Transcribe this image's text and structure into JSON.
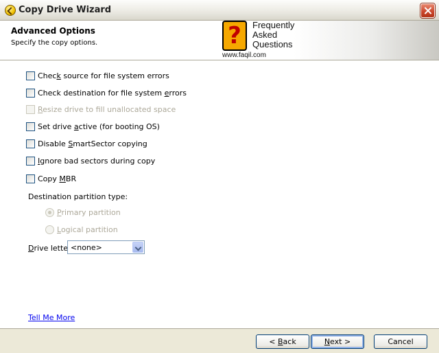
{
  "window": {
    "title": "Copy Drive Wizard"
  },
  "header": {
    "title": "Advanced Options",
    "subtitle": "Specify the copy options."
  },
  "banner": {
    "logo_glyph": "?",
    "line1": "Frequently",
    "line2": "Asked",
    "line3": "Questions",
    "url": "www.faqil.com"
  },
  "options": [
    {
      "pre": "Chec",
      "key": "k",
      "post": " source for file system errors",
      "checked": false,
      "enabled": true
    },
    {
      "pre": "Check destination for file system ",
      "key": "e",
      "post": "rrors",
      "checked": false,
      "enabled": true
    },
    {
      "pre": "",
      "key": "R",
      "post": "esize drive to fill unallocated space",
      "checked": false,
      "enabled": false
    },
    {
      "pre": "Set drive ",
      "key": "a",
      "post": "ctive (for booting OS)",
      "checked": false,
      "enabled": true
    },
    {
      "pre": "Disable ",
      "key": "S",
      "post": "martSector copying",
      "checked": false,
      "enabled": true
    },
    {
      "pre": "",
      "key": "I",
      "post": "gnore bad sectors during copy",
      "checked": false,
      "enabled": true
    },
    {
      "pre": "Copy ",
      "key": "M",
      "post": "BR",
      "checked": false,
      "enabled": true
    }
  ],
  "partition": {
    "label": "Destination partition type:",
    "primary": {
      "pre": "",
      "key": "P",
      "post": "rimary partition",
      "selected": true,
      "enabled": false
    },
    "logical": {
      "pre": "",
      "key": "L",
      "post": "ogical partition",
      "selected": false,
      "enabled": false
    }
  },
  "drive_letter": {
    "pre": "",
    "key": "D",
    "post": "rive letter:",
    "value": "<none>"
  },
  "link": {
    "pre": "",
    "key": "T",
    "post": "ell Me More"
  },
  "buttons": {
    "back": {
      "pre": "< ",
      "key": "B",
      "post": "ack"
    },
    "next": {
      "pre": "",
      "key": "N",
      "post": "ext >"
    },
    "cancel": {
      "label": "Cancel"
    }
  }
}
